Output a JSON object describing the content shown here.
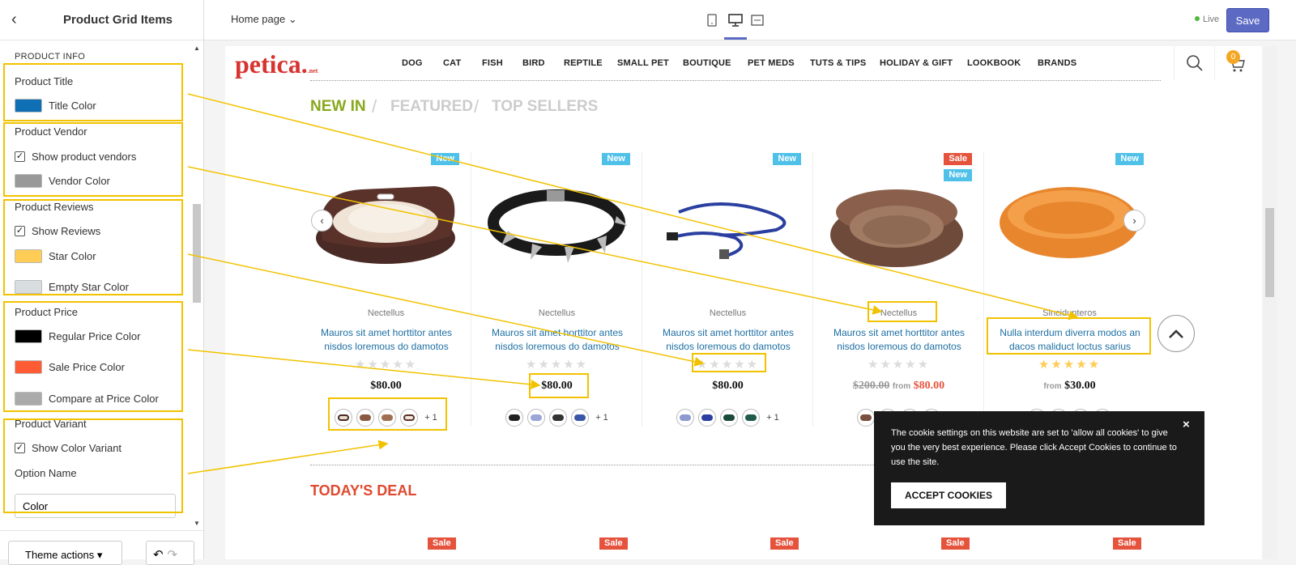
{
  "sidebar": {
    "title": "Product Grid Items",
    "back_icon": "chevron-left-icon",
    "section_label": "PRODUCT INFO",
    "product_title": {
      "heading": "Product Title",
      "title_color_label": "Title Color",
      "title_color": "#0e6fb5"
    },
    "product_vendor": {
      "heading": "Product Vendor",
      "show_label": "Show product vendors",
      "vendor_color_label": "Vendor Color",
      "vendor_color": "#999999"
    },
    "product_reviews": {
      "heading": "Product Reviews",
      "show_label": "Show Reviews",
      "star_color_label": "Star Color",
      "star_color": "#ffcc55",
      "empty_star_color_label": "Empty Star Color",
      "empty_star_color": "#d8dee0"
    },
    "product_price": {
      "heading": "Product Price",
      "regular_label": "Regular Price Color",
      "regular_color": "#000000",
      "sale_label": "Sale Price Color",
      "sale_color": "#ff5c35",
      "compare_label": "Compare at Price Color",
      "compare_color": "#aaaaaa"
    },
    "product_variant": {
      "heading": "Product Variant",
      "show_label": "Show Color Variant",
      "option_name_label": "Option Name",
      "option_name_value": "Color"
    },
    "footer": {
      "theme_actions_label": "Theme actions",
      "undo_icon": "undo-icon",
      "redo_icon": "redo-icon"
    }
  },
  "topbar": {
    "page_select": "Home page",
    "devices": [
      "mobile-icon",
      "desktop-icon",
      "fullwidth-icon"
    ],
    "live_label": "Live",
    "save_label": "Save"
  },
  "store": {
    "logo": "petica.",
    "logo_suffix": ".net",
    "nav": [
      "DOG",
      "CAT",
      "FISH",
      "BIRD",
      "REPTILE",
      "SMALL PET",
      "BOUTIQUE",
      "PET MEDS",
      "TUTS & TIPS",
      "HOLIDAY & GIFT",
      "LOOKBOOK",
      "BRANDS"
    ],
    "cart_count": "0",
    "tabs": [
      "NEW IN",
      "FEATURED",
      "TOP SELLERS"
    ],
    "tab_separator": "/",
    "products": [
      {
        "badges": [
          "New"
        ],
        "vendor": "Nectellus",
        "title": "Mauros sit amet horttitor antes nisdos loremous do damotos",
        "price": "$80.00",
        "variant_more": "+ 1"
      },
      {
        "badges": [
          "New"
        ],
        "vendor": "Nectellus",
        "title": "Mauros sit amet horttitor antes nisdos loremous do damotos",
        "price": "$80.00",
        "variant_more": "+ 1"
      },
      {
        "badges": [
          "New"
        ],
        "vendor": "Nectellus",
        "title": "Mauros sit amet horttitor antes nisdos loremous do damotos",
        "price": "$80.00",
        "variant_more": "+ 1"
      },
      {
        "badges": [
          "Sale",
          "New"
        ],
        "vendor": "Nectellus",
        "title": "Mauros sit amet horttitor antes nisdos loremous do damotos",
        "compare_price": "$200.00",
        "from_label": "from",
        "price": "$80.00"
      },
      {
        "badges": [
          "New"
        ],
        "vendor": "Sincidunteros",
        "title": "Nulla interdum diverra modos an dacos maliduct loctus sarius",
        "from_label": "from",
        "price": "$30.00"
      }
    ],
    "deal_heading": "TODAY'S DEAL",
    "deal_badges": [
      "Sale",
      "Sale",
      "Sale",
      "Sale",
      "Sale"
    ],
    "cookie": {
      "text": "The cookie settings on this website are set to 'allow all cookies' to give you the very best experience. Please click Accept Cookies to continue to use the site.",
      "button": "ACCEPT COOKIES",
      "close": "×"
    }
  },
  "colors": {
    "accent": "#5c6ac4",
    "highlight": "#f2c200",
    "new_badge": "#4fc1e9",
    "sale_badge": "#e5533d",
    "tab_active": "#88a81c"
  }
}
